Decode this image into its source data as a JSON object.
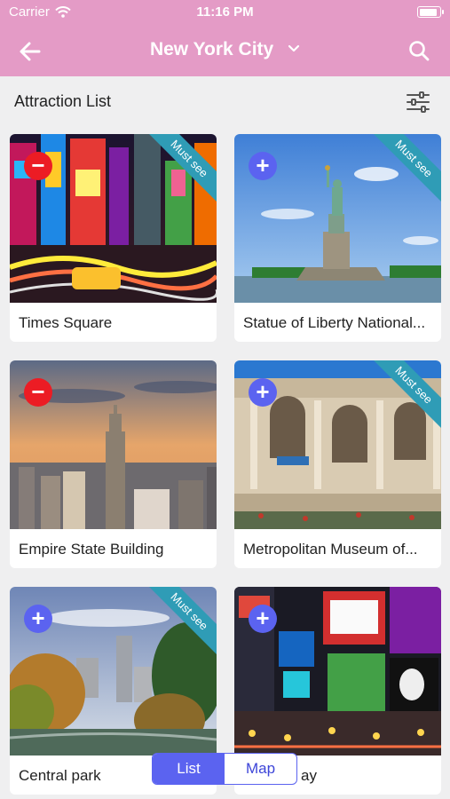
{
  "status": {
    "carrier": "Carrier",
    "time": "11:16 PM",
    "battery_level": 0.9
  },
  "header": {
    "title": "New York City"
  },
  "subheader": {
    "label": "Attraction List"
  },
  "attractions": [
    {
      "name": "Times Square",
      "action": "−",
      "action_type": "remove",
      "ribbon": "Must see"
    },
    {
      "name": "Statue of Liberty National...",
      "action": "+",
      "action_type": "add",
      "ribbon": "Must see"
    },
    {
      "name": "Empire State Building",
      "action": "−",
      "action_type": "remove",
      "ribbon": ""
    },
    {
      "name": "Metropolitan Museum of...",
      "action": "+",
      "action_type": "add",
      "ribbon": "Must see"
    },
    {
      "name": "Central park",
      "action": "+",
      "action_type": "add",
      "ribbon": "Must see"
    },
    {
      "name": "ay",
      "action": "+",
      "action_type": "add",
      "ribbon": ""
    }
  ],
  "view_toggle": {
    "list_label": "List",
    "map_label": "Map",
    "selected": "List"
  },
  "colors": {
    "header": "#e49bc6",
    "accent": "#5b63f0",
    "remove": "#ec1c24",
    "ribbon": "#2f9cb6"
  }
}
